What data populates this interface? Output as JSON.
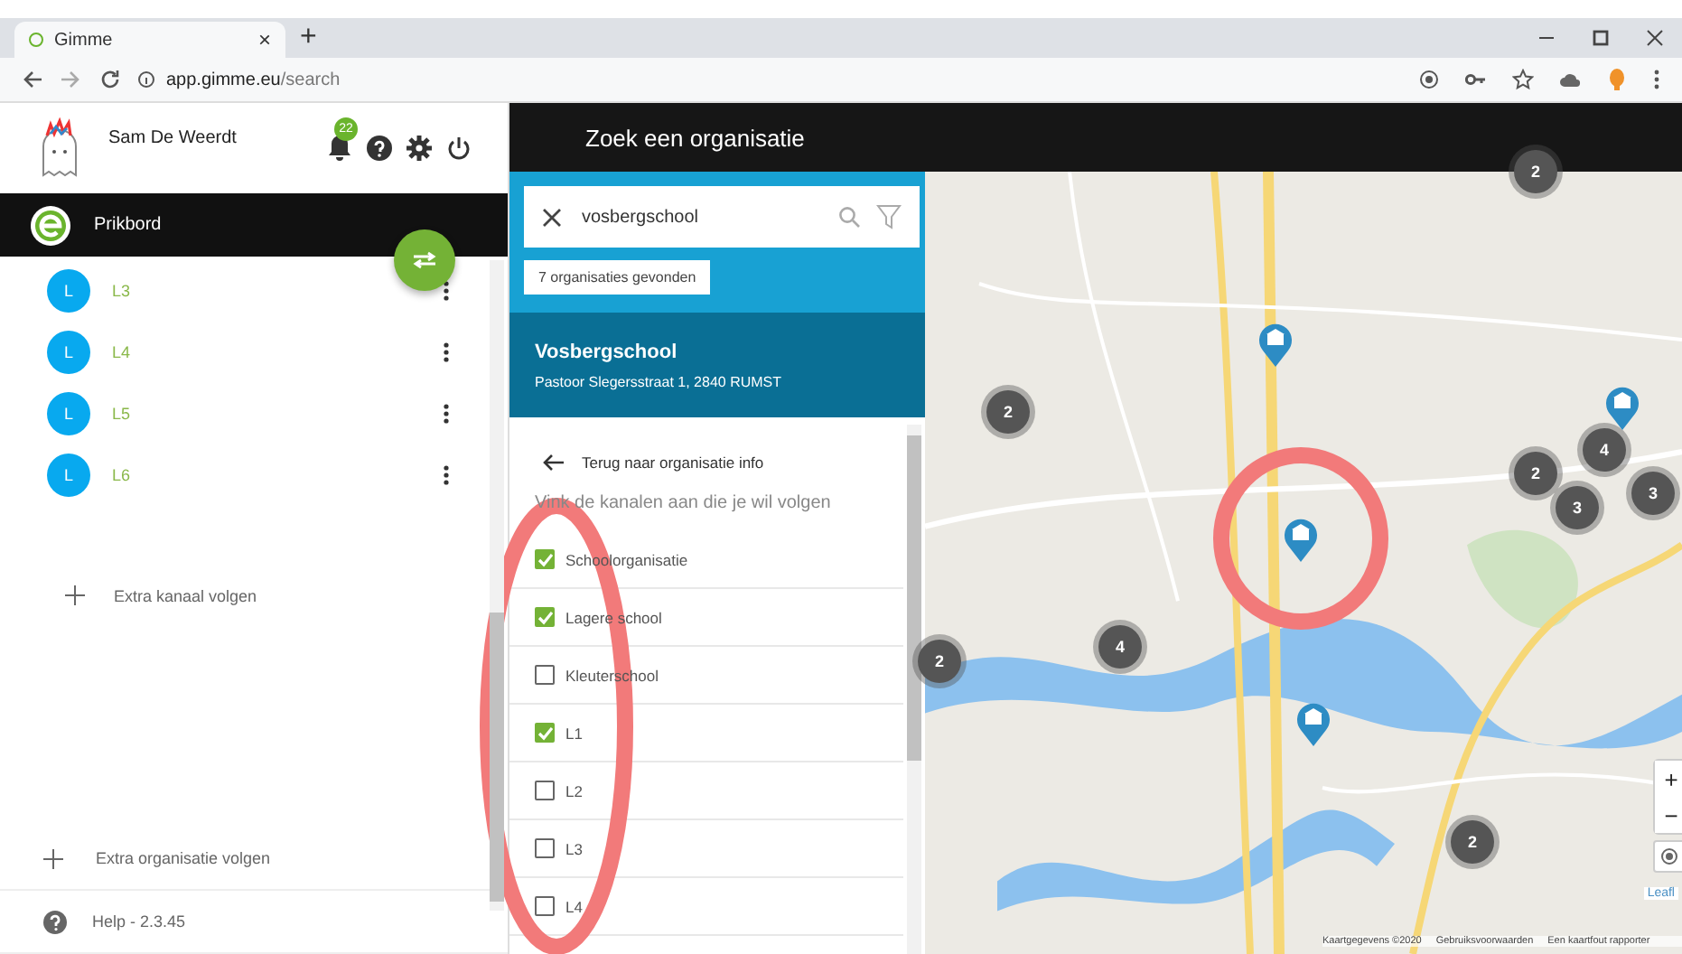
{
  "browser": {
    "tab": {
      "title": "Gimme",
      "close": "×"
    },
    "new_tab": "+",
    "url_host": "app.gimme.eu",
    "url_path": "/search"
  },
  "user": {
    "name": "Sam De Weerdt",
    "notifications": "22"
  },
  "board": {
    "title": "Prikbord"
  },
  "channels": [
    {
      "avatar": "L",
      "name": "L3"
    },
    {
      "avatar": "L",
      "name": "L4"
    },
    {
      "avatar": "L",
      "name": "L5"
    },
    {
      "avatar": "L",
      "name": "L6"
    }
  ],
  "add_channel": "Extra kanaal volgen",
  "add_organisation": "Extra organisatie volgen",
  "help": "Help - 2.3.45",
  "header": {
    "title": "Zoek een organisatie"
  },
  "search": {
    "value": "vosbergschool",
    "result_count": "7 organisaties gevonden"
  },
  "organisation": {
    "name": "Vosbergschool",
    "address": "Pastoor Slegersstraat 1, 2840 RUMST"
  },
  "back_link": "Terug naar organisatie info",
  "instruction": "Vink de kanalen aan die je wil volgen",
  "follow_channels": [
    {
      "label": "Schoolorganisatie",
      "checked": true
    },
    {
      "label": "Lagere school",
      "checked": true
    },
    {
      "label": "Kleuterschool",
      "checked": false
    },
    {
      "label": "L1",
      "checked": true
    },
    {
      "label": "L2",
      "checked": false
    },
    {
      "label": "L3",
      "checked": false
    },
    {
      "label": "L4",
      "checked": false
    }
  ],
  "map": {
    "kind": "picture",
    "clusters": [
      {
        "count": "2"
      },
      {
        "count": "2"
      },
      {
        "count": "4"
      },
      {
        "count": "2"
      },
      {
        "count": "3"
      },
      {
        "count": "3"
      },
      {
        "count": "4"
      },
      {
        "count": "2"
      },
      {
        "count": "2"
      }
    ],
    "pins": [
      {
        "kind": "school"
      },
      {
        "kind": "school"
      },
      {
        "kind": "school"
      },
      {
        "kind": "school"
      }
    ],
    "zoom_in": "+",
    "zoom_out": "−",
    "attribution": [
      "Kaartgegevens ©2020",
      "Gebruiksvoorwaarden",
      "Een kaartfout rapporter"
    ],
    "leaflet": "Leafl"
  },
  "annotations": [
    {
      "kind": "ring"
    },
    {
      "kind": "ring"
    }
  ]
}
